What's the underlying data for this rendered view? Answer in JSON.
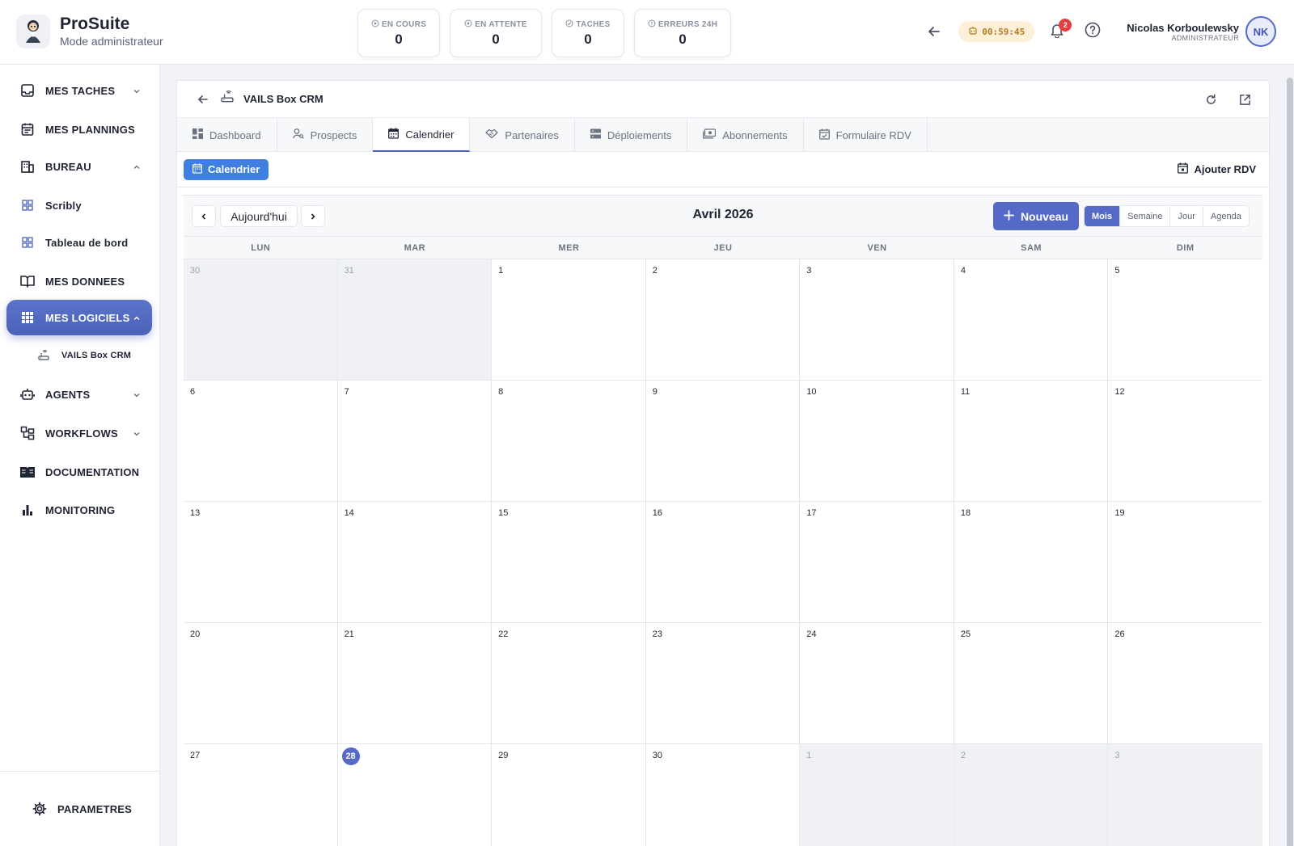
{
  "app": {
    "name": "ProSuite",
    "mode": "Mode administrateur"
  },
  "stats": [
    {
      "label": "EN COURS",
      "value": "0",
      "icon": "play-circle-icon"
    },
    {
      "label": "EN ATTENTE",
      "value": "0",
      "icon": "pause-circle-icon"
    },
    {
      "label": "TACHES",
      "value": "0",
      "icon": "check-circle-icon"
    },
    {
      "label": "ERREURS 24H",
      "value": "0",
      "icon": "info-circle-icon"
    }
  ],
  "header": {
    "timer": "00:59:45",
    "notifications": "2"
  },
  "user": {
    "name": "Nicolas Korboulewsky",
    "role": "ADMINISTRATEUR",
    "initials": "NK"
  },
  "sidebar": {
    "items": [
      {
        "label": "MES TACHES",
        "icon": "inbox-icon"
      },
      {
        "label": "MES PLANNINGS",
        "icon": "planning-icon"
      },
      {
        "label": "BUREAU",
        "icon": "building-icon"
      },
      {
        "label": "Scribly",
        "icon": "app-grid-icon"
      },
      {
        "label": "Tableau de bord",
        "icon": "app-grid-icon"
      },
      {
        "label": "MES DONNEES",
        "icon": "book-open-icon"
      },
      {
        "label": "MES LOGICIELS",
        "icon": "apps-icon"
      },
      {
        "label": "VAILS Box CRM",
        "icon": "router-icon"
      },
      {
        "label": "AGENTS",
        "icon": "robot-icon"
      },
      {
        "label": "WORKFLOWS",
        "icon": "workflow-icon"
      },
      {
        "label": "DOCUMENTATION",
        "icon": "documentation-icon"
      },
      {
        "label": "MONITORING",
        "icon": "bar-chart-icon"
      }
    ],
    "settings": "PARAMETRES"
  },
  "panel": {
    "title": "VAILS Box CRM",
    "tabs": [
      "Dashboard",
      "Prospects",
      "Calendrier",
      "Partenaires",
      "Déploiements",
      "Abonnements",
      "Formulaire RDV"
    ],
    "active_tab": "Calendrier",
    "subtab": "Calendrier",
    "add_rdv": "Ajouter RDV"
  },
  "calendar": {
    "today_label": "Aujourd'hui",
    "title": "Avril 2026",
    "new_label": "Nouveau",
    "views": [
      "Mois",
      "Semaine",
      "Jour",
      "Agenda"
    ],
    "active_view": "Mois",
    "weekdays": [
      "LUN",
      "MAR",
      "MER",
      "JEU",
      "VEN",
      "SAM",
      "DIM"
    ],
    "weeks": [
      [
        {
          "d": "30",
          "off": true
        },
        {
          "d": "31",
          "off": true
        },
        {
          "d": "1"
        },
        {
          "d": "2"
        },
        {
          "d": "3"
        },
        {
          "d": "4"
        },
        {
          "d": "5"
        }
      ],
      [
        {
          "d": "6"
        },
        {
          "d": "7"
        },
        {
          "d": "8"
        },
        {
          "d": "9"
        },
        {
          "d": "10"
        },
        {
          "d": "11"
        },
        {
          "d": "12"
        }
      ],
      [
        {
          "d": "13"
        },
        {
          "d": "14"
        },
        {
          "d": "15"
        },
        {
          "d": "16"
        },
        {
          "d": "17"
        },
        {
          "d": "18"
        },
        {
          "d": "19"
        }
      ],
      [
        {
          "d": "20"
        },
        {
          "d": "21"
        },
        {
          "d": "22"
        },
        {
          "d": "23"
        },
        {
          "d": "24"
        },
        {
          "d": "25"
        },
        {
          "d": "26"
        }
      ],
      [
        {
          "d": "27"
        },
        {
          "d": "28",
          "today": true
        },
        {
          "d": "29"
        },
        {
          "d": "30"
        },
        {
          "d": "1",
          "off": true
        },
        {
          "d": "2",
          "off": true
        },
        {
          "d": "3",
          "off": true
        }
      ]
    ]
  },
  "colors": {
    "accent": "#5569c7",
    "chip": "#3f7fe0",
    "timer_bg": "#fdf0d8",
    "badge": "#e53e3e"
  }
}
